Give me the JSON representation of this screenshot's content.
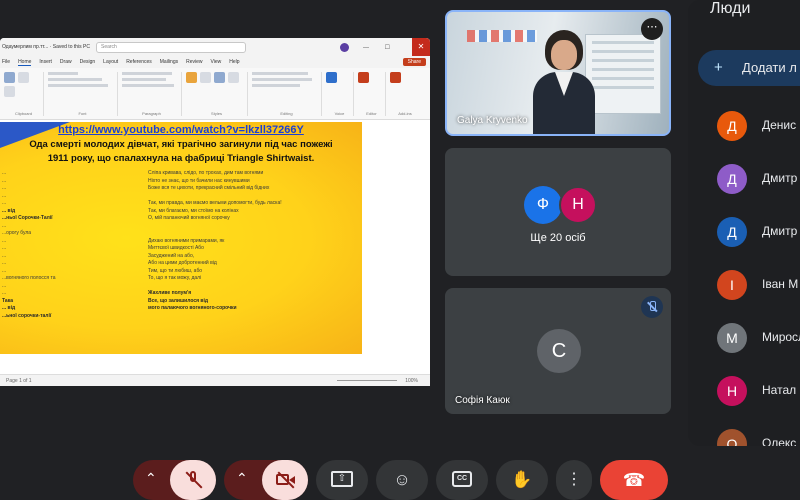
{
  "shared_window": {
    "filename": "Одаумерлим пр.тт... · Saved to this PC",
    "search_placeholder": "Search",
    "window_controls": "— ☐",
    "close": "✕",
    "menus": [
      "File",
      "Home",
      "Insert",
      "Draw",
      "Design",
      "Layout",
      "References",
      "Mailings",
      "Review",
      "View",
      "Help"
    ],
    "active_menu": "Home",
    "share_label": "Share",
    "ribbon_groups": [
      "Clipboard",
      "Font",
      "Paragraph",
      "Styles",
      "Editing",
      "Voice",
      "Editor",
      "Add-ins"
    ],
    "slide": {
      "link": "https://www.youtube.com/watch?v=lkzll37266Y",
      "heading_line1": "Ода смерті молодих дівчат, які трагічно загинули під час пожежі",
      "heading_line2": "1911 року, що спалахнула на фабриці Triangle Shirtwaist.",
      "left_col": [
        "...",
        "...",
        "...",
        "...",
        "...",
        "... від",
        "...ньої Сорочки-Талії",
        "...",
        "...орогу була",
        "...",
        "...",
        "...",
        "...",
        "...",
        "...вогняного полосся та",
        "...",
        "...",
        "Така",
        "... від",
        "...ьної сорочки-талії"
      ],
      "right_col": [
        "Сліпа кривава, слідо, по трохах, дим там вогнями",
        "Ніхто не знає, що ти бачили нас кинувшими",
        "Боже вся те цихоти, прекрасний смільний від бідних",
        "",
        "Так, ми правда, ми маємо вельми допомогти, будь ласка!",
        "Так, ми благаємо, ми стоїмо на колінах",
        "О, мій паланючий вогняної сорочку",
        "",
        "",
        "Дихаю вогняними примарами, як",
        "Миттєвої швидкості Або",
        "Засуджений на або,",
        "Або на цими добротенний від",
        "Тим, що ти любиш, або",
        "То, що я так можу, далі",
        "",
        "Жахливе полум'я",
        "Все, що залишилося від",
        "мого палаючого вогняного-сорочки"
      ]
    },
    "status": {
      "page": "Page 1 of 1",
      "zoom": "100%"
    }
  },
  "tiles": {
    "speaker": {
      "name": "Galya Kryvenko",
      "more_icon": "⋯"
    },
    "group": {
      "avatars": [
        {
          "letter": "Ф",
          "color": "#1a73e8"
        },
        {
          "letter": "Н",
          "color": "#c5105d"
        }
      ],
      "label": "Ще 20 осіб"
    },
    "muted": {
      "letter": "С",
      "name": "Софія Каюк"
    }
  },
  "people": {
    "title": "Люди",
    "add_label": "Додати л",
    "list": [
      {
        "letter": "Д",
        "color": "#e8590c",
        "name": "Денис"
      },
      {
        "letter": "Д",
        "color": "#8e5cc8",
        "name": "Дмитр"
      },
      {
        "letter": "Д",
        "color": "#1a5fb4",
        "name": "Дмитр"
      },
      {
        "letter": "І",
        "color": "#d2451e",
        "name": "Іван М"
      },
      {
        "letter": "М",
        "color": "#70757a",
        "name": "Миросл"
      },
      {
        "letter": "Н",
        "color": "#c5105d",
        "name": "Натал"
      },
      {
        "letter": "О",
        "color": "#a0522d",
        "name": "Олекс"
      }
    ]
  },
  "controls": {
    "chevron": "⌃",
    "present_icon": "⇧",
    "emoji_icon": "☺",
    "cc_label": "CC",
    "hand_icon": "✋",
    "more_icon": "⋮",
    "hangup_icon": "☎"
  }
}
